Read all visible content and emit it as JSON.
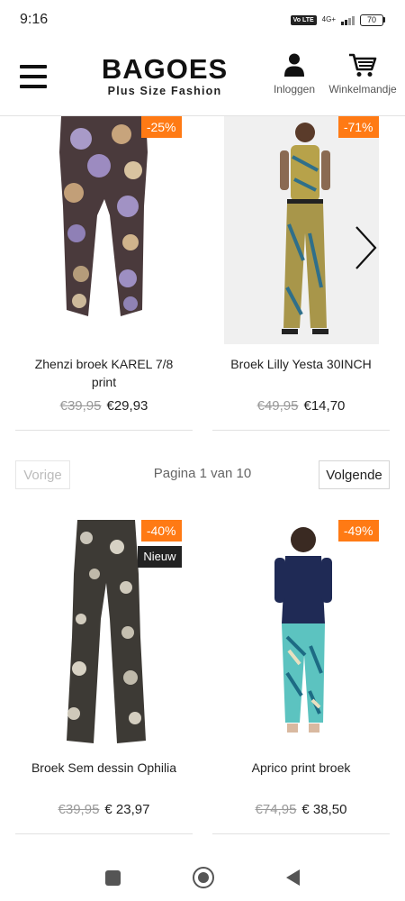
{
  "status_bar": {
    "time": "9:16",
    "volte": "Vo LTE",
    "network": "4G+",
    "battery": "70"
  },
  "header": {
    "logo_main": "BAGOES",
    "logo_sub": "Plus Size Fashion",
    "login_label": "Inloggen",
    "cart_label": "Winkelmandje",
    "icons": {
      "menu": "hamburger-menu-icon",
      "login": "user-icon",
      "cart": "shopping-cart-icon"
    }
  },
  "products_top": [
    {
      "title": "Zhenzi broek KAREL 7/8 print",
      "discount": "-25%",
      "old_price": "€39,95",
      "new_price": "€29,93"
    },
    {
      "title": "Broek Lilly Yesta 30INCH",
      "discount": "-71%",
      "old_price": "€49,95",
      "new_price": "€14,70"
    }
  ],
  "pagination": {
    "prev_label": "Vorige",
    "info": "Pagina 1 van 10",
    "next_label": "Volgende"
  },
  "products_bottom": [
    {
      "title": "Broek Sem dessin Ophilia",
      "discount": "-40%",
      "new_badge": "Nieuw",
      "old_price": "€39,95",
      "new_price": "€ 23,97"
    },
    {
      "title": "Aprico print broek",
      "discount": "-49%",
      "old_price": "€74,95",
      "new_price": "€ 38,50"
    }
  ],
  "colors": {
    "discount_badge": "#ff7a14",
    "new_badge": "#222222",
    "divider": "#e2e2e2"
  }
}
